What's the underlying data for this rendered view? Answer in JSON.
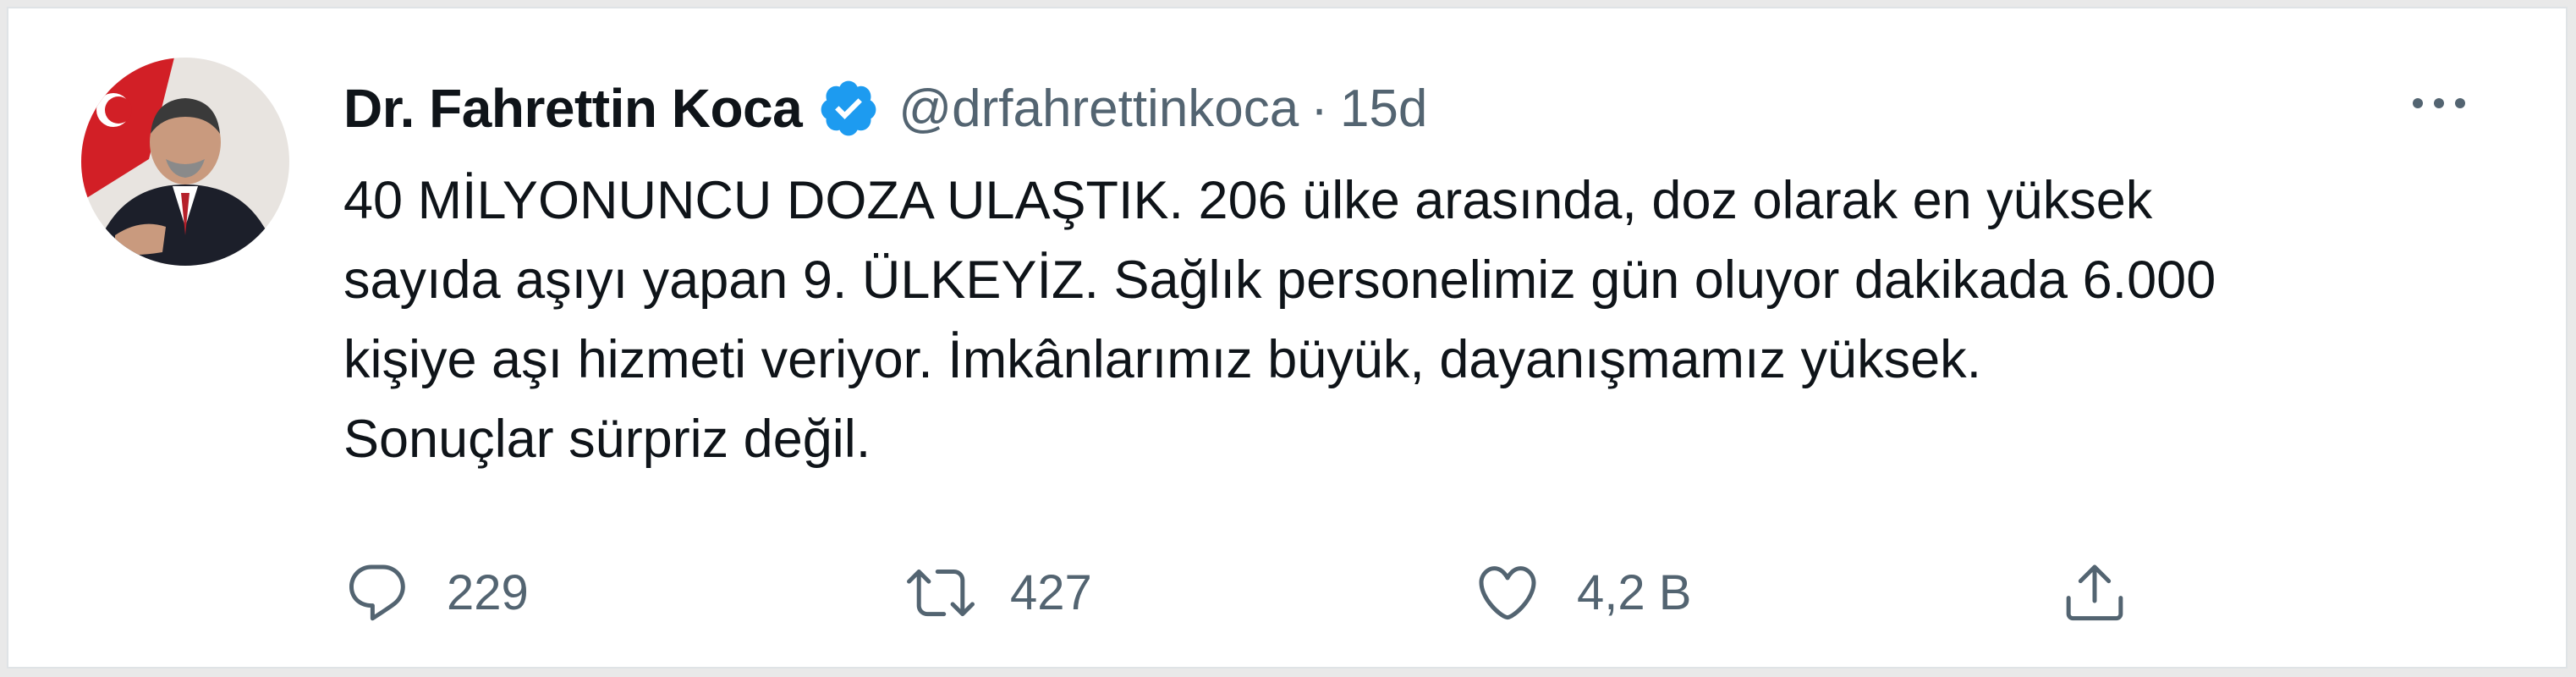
{
  "author": {
    "name": "Dr. Fahrettin Koca",
    "handle": "@drfahrettinkoca",
    "separator": "·",
    "time": "15d"
  },
  "tweet": {
    "text": "40 MİLYONUNCU DOZA ULAŞTIK. 206 ülke arasında, doz olarak en yüksek\nsayıda aşıyı yapan 9. ÜLKEYİZ. Sağlık personelimiz gün oluyor dakikada 6.000\nkişiye aşı hizmeti veriyor. İmkânlarımız büyük, dayanışmamız yüksek.\nSonuçlar sürpriz değil."
  },
  "actions": {
    "reply_count": "229",
    "retweet_count": "427",
    "like_count": "4,2 B"
  },
  "icons": {
    "verified": "verified-badge-icon",
    "more": "more-options-icon",
    "reply": "reply-icon",
    "retweet": "retweet-icon",
    "like": "like-icon",
    "share": "share-icon"
  },
  "colors": {
    "verified_blue": "#1d9bf0",
    "secondary_text": "#536471",
    "primary_text": "#0f1419"
  }
}
